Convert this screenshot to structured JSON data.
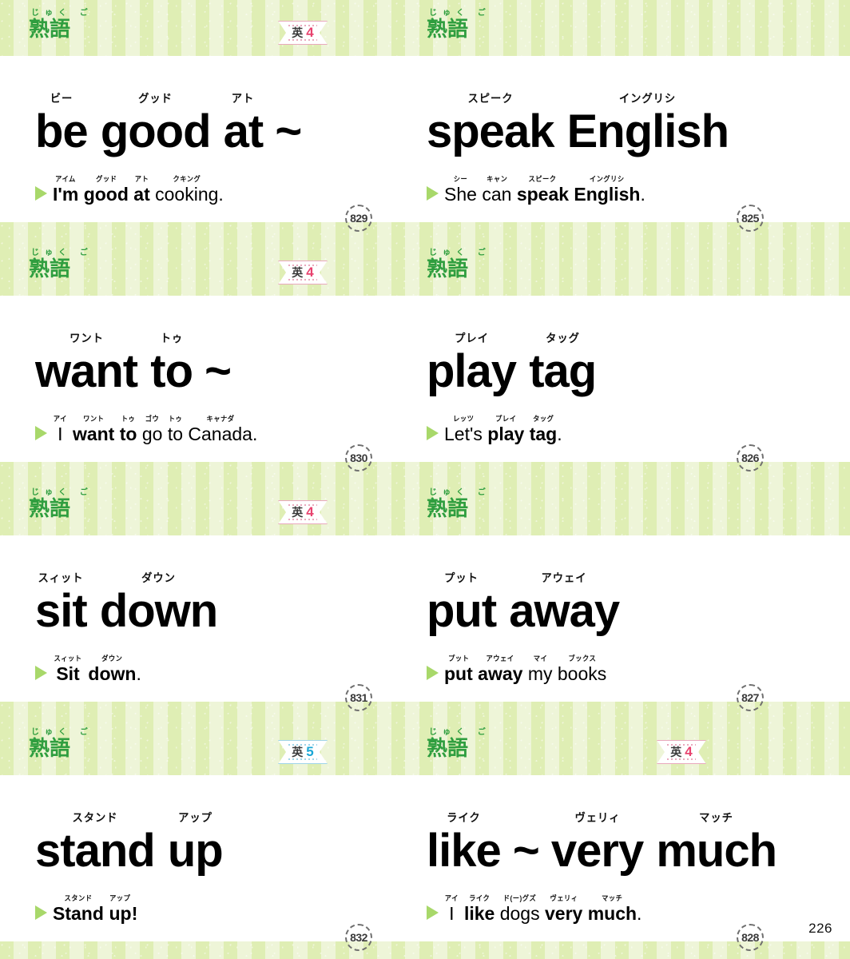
{
  "page": {
    "page_number": "226",
    "colors": {
      "band_light": "#eef5d8",
      "band_dark": "#dfeeb4",
      "jukugo_green": "#2f9e3f",
      "triangle_green": "#a8d86a",
      "level4_pink": "#e8436f",
      "level5_blue": "#1aa7d6"
    }
  },
  "labels": {
    "category_furigana": "じゅく ご",
    "category_kanji": "熟語",
    "subject_char": "英"
  },
  "cards": [
    {
      "id": 829,
      "side": "left",
      "row": 1,
      "number": "829",
      "level": "4",
      "level_color": "pink",
      "headword_tokens": [
        {
          "word": "be",
          "ruby": "ビー"
        },
        {
          "word": " ",
          "ruby": ""
        },
        {
          "word": "good",
          "ruby": "グッド"
        },
        {
          "word": " ",
          "ruby": ""
        },
        {
          "word": "at",
          "ruby": "アト"
        },
        {
          "word": " ~",
          "ruby": ""
        }
      ],
      "example_tokens": [
        {
          "word": "I'm",
          "ruby": "アイム",
          "bold": true
        },
        {
          "word": " ",
          "ruby": "",
          "bold": false
        },
        {
          "word": "good",
          "ruby": "グッド",
          "bold": true
        },
        {
          "word": " ",
          "ruby": "",
          "bold": false
        },
        {
          "word": "at",
          "ruby": "アト",
          "bold": true
        },
        {
          "word": " ",
          "ruby": "",
          "bold": false
        },
        {
          "word": "cooking",
          "ruby": "クキング",
          "bold": false
        },
        {
          "word": ".",
          "ruby": "",
          "bold": false
        }
      ]
    },
    {
      "id": 825,
      "side": "right",
      "row": 1,
      "number": "825",
      "level": null,
      "level_color": null,
      "headword_tokens": [
        {
          "word": "speak",
          "ruby": "スピーク"
        },
        {
          "word": " ",
          "ruby": ""
        },
        {
          "word": "English",
          "ruby": "イングリシ"
        }
      ],
      "example_tokens": [
        {
          "word": "She",
          "ruby": "シー",
          "bold": false
        },
        {
          "word": " ",
          "ruby": "",
          "bold": false
        },
        {
          "word": "can",
          "ruby": "キャン",
          "bold": false
        },
        {
          "word": " ",
          "ruby": "",
          "bold": false
        },
        {
          "word": "speak",
          "ruby": "スピーク",
          "bold": true
        },
        {
          "word": " ",
          "ruby": "",
          "bold": false
        },
        {
          "word": "English",
          "ruby": "イングリシ",
          "bold": true
        },
        {
          "word": ".",
          "ruby": "",
          "bold": false
        }
      ]
    },
    {
      "id": 830,
      "side": "left",
      "row": 2,
      "number": "830",
      "level": "4",
      "level_color": "pink",
      "headword_tokens": [
        {
          "word": "want",
          "ruby": "ワント"
        },
        {
          "word": " ",
          "ruby": ""
        },
        {
          "word": "to",
          "ruby": "トゥ"
        },
        {
          "word": " ~",
          "ruby": ""
        }
      ],
      "example_tokens": [
        {
          "word": "I",
          "ruby": "アイ",
          "bold": false
        },
        {
          "word": " ",
          "ruby": "",
          "bold": false
        },
        {
          "word": "want",
          "ruby": "ワント",
          "bold": true
        },
        {
          "word": " ",
          "ruby": "",
          "bold": false
        },
        {
          "word": "to",
          "ruby": "トゥ",
          "bold": true
        },
        {
          "word": " ",
          "ruby": "",
          "bold": false
        },
        {
          "word": "go",
          "ruby": "ゴウ",
          "bold": false
        },
        {
          "word": " ",
          "ruby": "",
          "bold": false
        },
        {
          "word": "to",
          "ruby": "トゥ",
          "bold": false
        },
        {
          "word": " ",
          "ruby": "",
          "bold": false
        },
        {
          "word": "Canada",
          "ruby": "キャナダ",
          "bold": false
        },
        {
          "word": ".",
          "ruby": "",
          "bold": false
        }
      ]
    },
    {
      "id": 826,
      "side": "right",
      "row": 2,
      "number": "826",
      "level": null,
      "level_color": null,
      "headword_tokens": [
        {
          "word": "play",
          "ruby": "プレイ"
        },
        {
          "word": " ",
          "ruby": ""
        },
        {
          "word": "tag",
          "ruby": "タッグ"
        }
      ],
      "example_tokens": [
        {
          "word": "Let's",
          "ruby": "レッツ",
          "bold": false
        },
        {
          "word": " ",
          "ruby": "",
          "bold": false
        },
        {
          "word": "play",
          "ruby": "プレイ",
          "bold": true
        },
        {
          "word": " ",
          "ruby": "",
          "bold": false
        },
        {
          "word": "tag",
          "ruby": "タッグ",
          "bold": true
        },
        {
          "word": ".",
          "ruby": "",
          "bold": false
        }
      ]
    },
    {
      "id": 831,
      "side": "left",
      "row": 3,
      "number": "831",
      "level": "4",
      "level_color": "pink",
      "headword_tokens": [
        {
          "word": "sit",
          "ruby": "スィット"
        },
        {
          "word": " ",
          "ruby": ""
        },
        {
          "word": "down",
          "ruby": "ダウン"
        }
      ],
      "example_tokens": [
        {
          "word": "Sit",
          "ruby": "スィット",
          "bold": true
        },
        {
          "word": " ",
          "ruby": "",
          "bold": false
        },
        {
          "word": "down",
          "ruby": "ダウン",
          "bold": true
        },
        {
          "word": ".",
          "ruby": "",
          "bold": false
        }
      ]
    },
    {
      "id": 827,
      "side": "right",
      "row": 3,
      "number": "827",
      "level": null,
      "level_color": null,
      "headword_tokens": [
        {
          "word": "put",
          "ruby": "プット"
        },
        {
          "word": " ",
          "ruby": ""
        },
        {
          "word": "away",
          "ruby": "アウェイ"
        }
      ],
      "example_tokens": [
        {
          "word": "put",
          "ruby": "プット",
          "bold": true
        },
        {
          "word": " ",
          "ruby": "",
          "bold": false
        },
        {
          "word": "away",
          "ruby": "アウェイ",
          "bold": true
        },
        {
          "word": " ",
          "ruby": "",
          "bold": false
        },
        {
          "word": "my",
          "ruby": "マイ",
          "bold": false
        },
        {
          "word": " ",
          "ruby": "",
          "bold": false
        },
        {
          "word": "books",
          "ruby": "ブックス",
          "bold": false
        }
      ]
    },
    {
      "id": 832,
      "side": "left",
      "row": 4,
      "number": "832",
      "level": "5",
      "level_color": "blue",
      "headword_tokens": [
        {
          "word": "stand",
          "ruby": "スタンド"
        },
        {
          "word": " ",
          "ruby": ""
        },
        {
          "word": "up",
          "ruby": "アップ"
        }
      ],
      "example_tokens": [
        {
          "word": "Stand",
          "ruby": "スタンド",
          "bold": true
        },
        {
          "word": " ",
          "ruby": "",
          "bold": false
        },
        {
          "word": "up",
          "ruby": "アップ",
          "bold": true
        },
        {
          "word": "!",
          "ruby": "",
          "bold": true
        }
      ]
    },
    {
      "id": 828,
      "side": "right",
      "row": 4,
      "number": "828",
      "level": "4",
      "level_color": "pink",
      "headword_tokens": [
        {
          "word": "like",
          "ruby": "ライク"
        },
        {
          "word": " ~ ",
          "ruby": ""
        },
        {
          "word": "very",
          "ruby": "ヴェリィ"
        },
        {
          "word": " ",
          "ruby": ""
        },
        {
          "word": "much",
          "ruby": "マッチ"
        }
      ],
      "example_tokens": [
        {
          "word": "I",
          "ruby": "アイ",
          "bold": false
        },
        {
          "word": " ",
          "ruby": "",
          "bold": false
        },
        {
          "word": "like",
          "ruby": "ライク",
          "bold": true
        },
        {
          "word": " ",
          "ruby": "",
          "bold": false
        },
        {
          "word": "dogs",
          "ruby": "ド(ー)グズ",
          "bold": false
        },
        {
          "word": " ",
          "ruby": "",
          "bold": false
        },
        {
          "word": "very",
          "ruby": "ヴェリィ",
          "bold": true
        },
        {
          "word": " ",
          "ruby": "",
          "bold": false
        },
        {
          "word": "much",
          "ruby": "マッチ",
          "bold": true
        },
        {
          "word": ".",
          "ruby": "",
          "bold": false
        }
      ]
    }
  ]
}
